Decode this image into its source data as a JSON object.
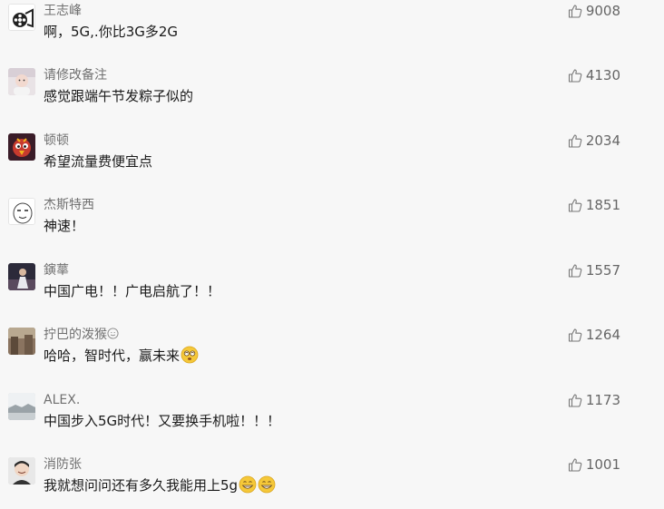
{
  "comments": [
    {
      "name": "王志峰",
      "text": "啊，5G,.你比3G多2G",
      "likes": "9008",
      "avatar": "film-reel-avatar"
    },
    {
      "name": "请修改备注",
      "text": "感觉跟端午节发粽子似的",
      "likes": "4130",
      "avatar": "baby-photo-avatar"
    },
    {
      "name": "顿顿",
      "text": "希望流量费便宜点",
      "likes": "2034",
      "avatar": "cartoon-bird-avatar"
    },
    {
      "name": "杰斯特西",
      "text": "神速！",
      "likes": "1851",
      "avatar": "meme-face-avatar"
    },
    {
      "name": "鏔蕐",
      "text": "中国广电！！广电启航了！！",
      "likes": "1557",
      "avatar": "performer-photo-avatar"
    },
    {
      "name": "拧巴的泼猴",
      "text": "哈哈，智时代，赢未来",
      "likes": "1264",
      "avatar": "street-photo-avatar"
    },
    {
      "name": "ALEX.",
      "text": "中国步入5G时代！又要换手机啦！！！",
      "likes": "1173",
      "avatar": "landscape-photo-avatar"
    },
    {
      "name": "消防张",
      "text": "我就想问问还有多久我能用上5g",
      "likes": "1001",
      "avatar": "man-photo-avatar"
    }
  ],
  "icons": {
    "like": "thumbs-up-icon",
    "emoji_dizzy": "dizzy-face-emoji",
    "emoji_grin": "grinning-face-emoji",
    "emoji_smile": "smiling-face-emoji"
  },
  "colors": {
    "background": "#f7f7f7",
    "name": "#707070",
    "text": "#1a1a1a",
    "likes": "#666666"
  }
}
